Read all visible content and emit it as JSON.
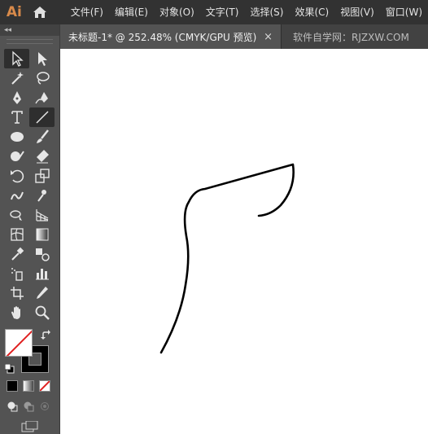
{
  "app": {
    "logo": "Ai",
    "brand_color": "#d88a4a"
  },
  "menu": {
    "items": [
      "文件(F)",
      "编辑(E)",
      "对象(O)",
      "文字(T)",
      "选择(S)",
      "效果(C)",
      "视图(V)",
      "窗口(W)"
    ]
  },
  "tabs": {
    "active_title": "未标题-1* @ 252.48% (CMYK/GPU 预览)",
    "close_symbol": "×",
    "other_title": "软件自学网：RJZXW.COM"
  },
  "toolbar": {
    "collapse_symbol": "◂◂",
    "tools": [
      [
        "selection-tool",
        "direct-selection-tool"
      ],
      [
        "magic-wand-tool",
        "lasso-tool"
      ],
      [
        "pen-tool",
        "curvature-tool"
      ],
      [
        "type-tool",
        "line-segment-tool"
      ],
      [
        "ellipse-tool",
        "paintbrush-tool"
      ],
      [
        "shaper-tool",
        "eraser-tool"
      ],
      [
        "rotate-tool",
        "scale-tool"
      ],
      [
        "warp-tool",
        "puppet-warp-tool"
      ],
      [
        "shape-builder-tool",
        "perspective-grid-tool"
      ],
      [
        "mesh-tool",
        "gradient-tool"
      ],
      [
        "eyedropper-tool",
        "blend-tool"
      ],
      [
        "symbol-sprayer-tool",
        "column-graph-tool"
      ],
      [
        "artboard-tool",
        "slice-tool"
      ],
      [
        "hand-tool",
        "zoom-tool"
      ]
    ],
    "selected_tool": "selection-tool",
    "fill_color": "none",
    "stroke_color": "#000000"
  },
  "canvas": {
    "background": "#ffffff",
    "path_stroke": "#000000"
  }
}
